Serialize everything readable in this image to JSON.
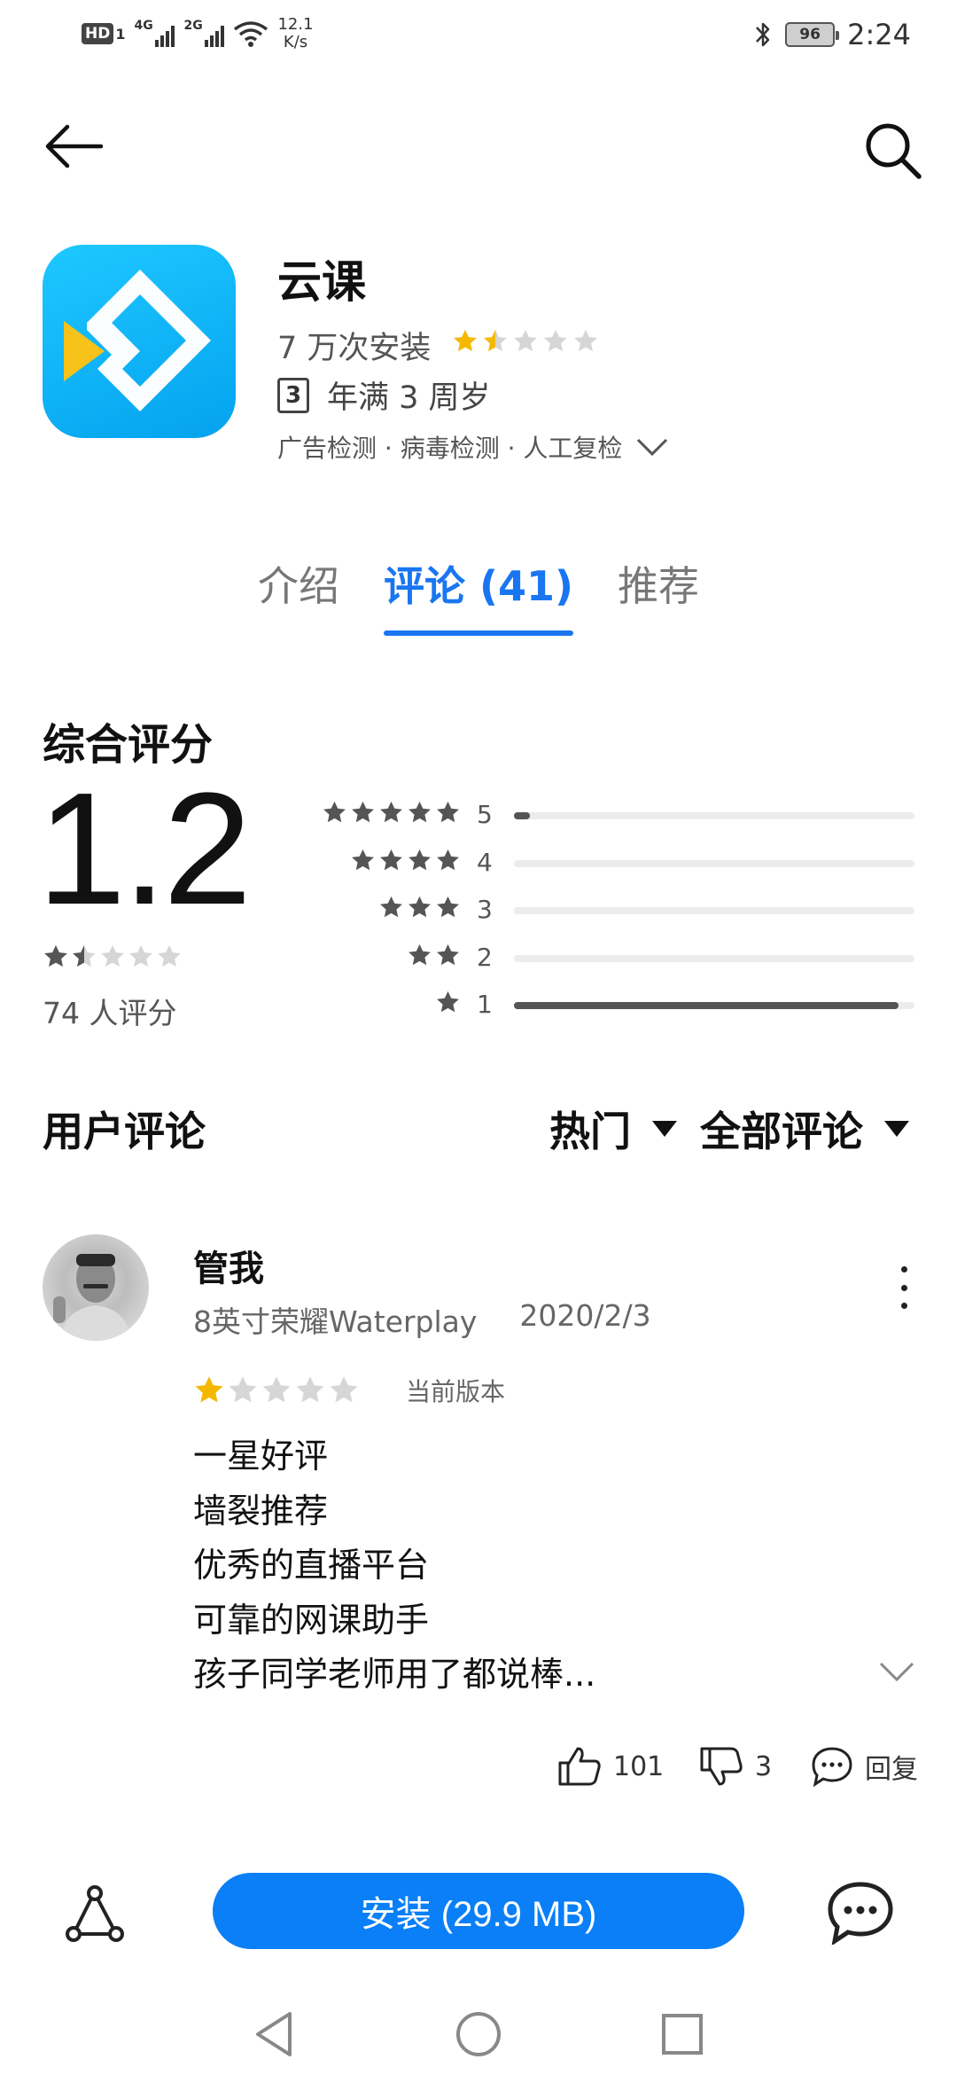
{
  "status_bar": {
    "hd_label": "HD",
    "hd_sim": "1",
    "sim1_type": "4G",
    "sim2_type": "2G",
    "net_speed_value": "12.1",
    "net_speed_unit": "K/s",
    "battery_level": "96",
    "time": "2:24"
  },
  "app": {
    "name": "云课",
    "installs": "7 万次安装",
    "rating_stars": 1.5,
    "age_badge": "3",
    "age_text": "年满 3 周岁",
    "checks": "广告检测 · 病毒检测 · 人工复检"
  },
  "tabs": [
    {
      "label": "介绍",
      "active": false
    },
    {
      "label": "评论 (41)",
      "active": true
    },
    {
      "label": "推荐",
      "active": false
    }
  ],
  "rating_summary": {
    "title": "综合评分",
    "score": "1.2",
    "stars": 1.5,
    "rater_count": "74 人评分",
    "distribution": [
      {
        "stars": "5",
        "fraction": 0.04
      },
      {
        "stars": "4",
        "fraction": 0.0
      },
      {
        "stars": "3",
        "fraction": 0.0
      },
      {
        "stars": "2",
        "fraction": 0.0
      },
      {
        "stars": "1",
        "fraction": 0.96
      }
    ]
  },
  "reviews_header": {
    "title": "用户评论",
    "sort_label": "热门",
    "filter_label": "全部评论"
  },
  "review": {
    "author": "管我",
    "device": "8英寸荣耀Waterplay",
    "date": "2020/2/3",
    "stars": 1,
    "version_tag": "当前版本",
    "lines": [
      "一星好评",
      "墙裂推荐",
      "优秀的直播平台",
      "可靠的网课助手",
      "孩子同学老师用了都说棒..."
    ],
    "likes": "101",
    "dislikes": "3",
    "reply_label": "回复"
  },
  "bottom_bar": {
    "install_label": "安装 (29.9 MB)"
  },
  "colors": {
    "accent": "#1976f0",
    "install_button": "#0a7ff7",
    "star_gold": "#f5b800",
    "star_gray": "#d6d6d6",
    "icon_bg": "#05a2ef"
  }
}
